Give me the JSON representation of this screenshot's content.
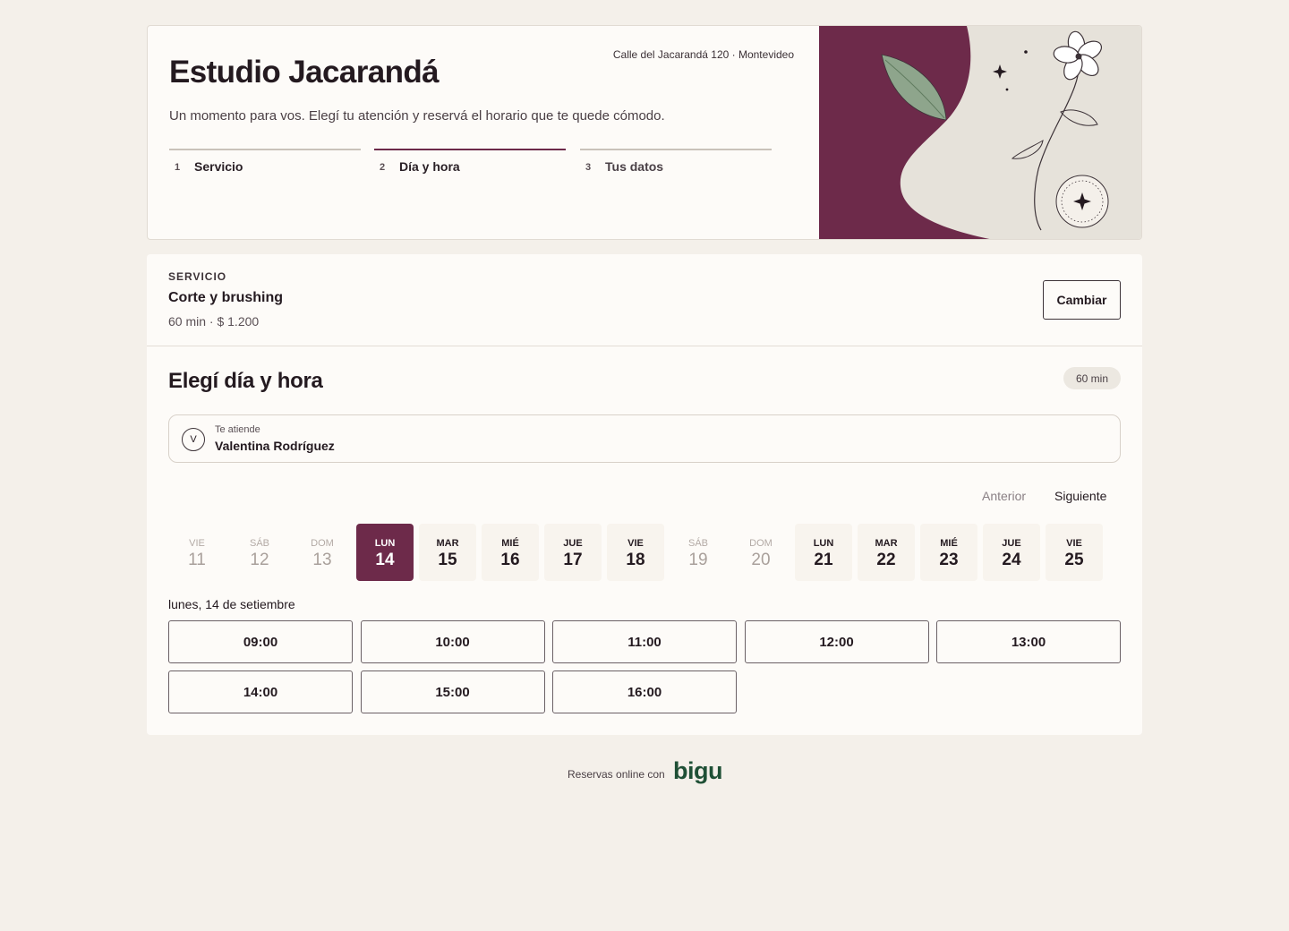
{
  "brand": {
    "title": "Estudio Jacarandá",
    "address": "Calle del Jacarandá 120 · Montevideo",
    "tagline": "Un momento para vos. Elegí tu atención y reservá el horario que te quede cómodo."
  },
  "steps": [
    {
      "num": "1",
      "label": "Servicio",
      "state": "done"
    },
    {
      "num": "2",
      "label": "Día y hora",
      "state": "active"
    },
    {
      "num": "3",
      "label": "Tus datos",
      "state": "pending"
    }
  ],
  "service": {
    "eyebrow": "SERVICIO",
    "name": "Corte y brushing",
    "meta": "60 min · $ 1.200",
    "change_label": "Cambiar"
  },
  "schedule": {
    "title": "Elegí día y hora",
    "duration_badge": "60 min",
    "staff_caption": "Te atiende",
    "staff_name": "Valentina Rodríguez",
    "staff_initial": "V",
    "prev_label": "Anterior",
    "next_label": "Siguiente",
    "days": [
      {
        "dow": "VIE",
        "day": "11",
        "state": "off"
      },
      {
        "dow": "SÁB",
        "day": "12",
        "state": "off"
      },
      {
        "dow": "DOM",
        "day": "13",
        "state": "off"
      },
      {
        "dow": "LUN",
        "day": "14",
        "state": "selected"
      },
      {
        "dow": "MAR",
        "day": "15",
        "state": "available"
      },
      {
        "dow": "MIÉ",
        "day": "16",
        "state": "available"
      },
      {
        "dow": "JUE",
        "day": "17",
        "state": "available"
      },
      {
        "dow": "VIE",
        "day": "18",
        "state": "available"
      },
      {
        "dow": "SÁB",
        "day": "19",
        "state": "off"
      },
      {
        "dow": "DOM",
        "day": "20",
        "state": "off"
      },
      {
        "dow": "LUN",
        "day": "21",
        "state": "available"
      },
      {
        "dow": "MAR",
        "day": "22",
        "state": "available"
      },
      {
        "dow": "MIÉ",
        "day": "23",
        "state": "available"
      },
      {
        "dow": "JUE",
        "day": "24",
        "state": "available"
      },
      {
        "dow": "VIE",
        "day": "25",
        "state": "available"
      }
    ],
    "selected_date_label": "lunes, 14 de setiembre",
    "slots": [
      "09:00",
      "10:00",
      "11:00",
      "12:00",
      "13:00",
      "14:00",
      "15:00",
      "16:00"
    ]
  },
  "footer": {
    "text": "Reservas online con",
    "logo": "bigu"
  },
  "colors": {
    "accent": "#6d2a4a",
    "background": "#f4f0ea",
    "card": "#fdfbf8",
    "leaf": "#8ea58c",
    "logo": "#1f5036"
  },
  "icons": {
    "decor": "flower-illustration",
    "badge": "sparkle-icon"
  }
}
